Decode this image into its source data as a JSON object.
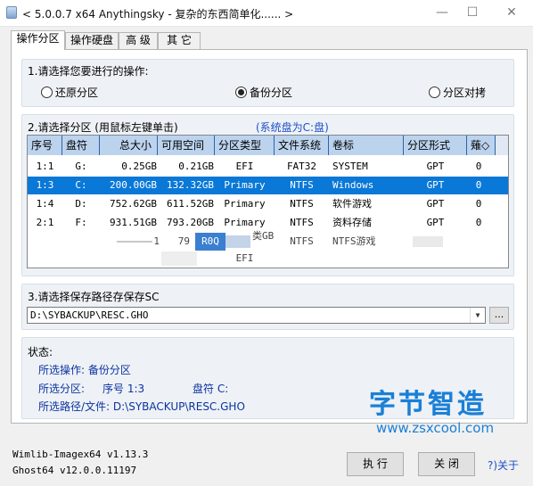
{
  "window": {
    "title": "< 5.0.0.7 x64 Anythingsky - 复杂的东西简单化...... >",
    "minimize": "—",
    "maximize": "☐",
    "close": "✕"
  },
  "tabs": [
    {
      "label": "操作分区",
      "active": true
    },
    {
      "label": "操作硬盘",
      "active": false
    },
    {
      "label": "高 级",
      "active": false
    },
    {
      "label": "其 它",
      "active": false
    }
  ],
  "operation": {
    "title": "1.请选择您要进行的操作:",
    "options": [
      {
        "label": "还原分区",
        "selected": false
      },
      {
        "label": "备份分区",
        "selected": true
      },
      {
        "label": "分区对拷",
        "selected": false
      }
    ]
  },
  "partition": {
    "title": "2.请选择分区 (用鼠标左键单击)",
    "system_disk_note": "(系统盘为C:盘)",
    "columns": [
      "序号",
      "盘符",
      "总大小",
      "可用空间",
      "分区类型",
      "文件系统",
      "卷标",
      "分区形式",
      "薙◇"
    ],
    "rows": [
      {
        "index": "1:1",
        "drive": "G:",
        "total": "0.25GB",
        "free": "0.21GB",
        "type": "EFI",
        "fs": "FAT32",
        "label": "SYSTEM",
        "scheme": "GPT",
        "last": "0",
        "selected": false
      },
      {
        "index": "1:3",
        "drive": "C:",
        "total": "200.00GB",
        "free": "132.32GB",
        "type": "Primary",
        "fs": "NTFS",
        "label": "Windows",
        "scheme": "GPT",
        "last": "0",
        "selected": true
      },
      {
        "index": "1:4",
        "drive": "D:",
        "total": "752.62GB",
        "free": "611.52GB",
        "type": "Primary",
        "fs": "NTFS",
        "label": "软件游戏",
        "scheme": "GPT",
        "last": "0",
        "selected": false
      },
      {
        "index": "2:1",
        "drive": "F:",
        "total": "931.51GB",
        "free": "793.20GB",
        "type": "Primary",
        "fs": "NTFS",
        "label": "资料存储",
        "scheme": "GPT",
        "last": "0",
        "selected": false
      },
      {
        "index": "",
        "drive": "",
        "total": "1",
        "free": "79",
        "type": "R0Q",
        "fs": "NTFS",
        "label": "NTFS游戏",
        "scheme": "",
        "last": "",
        "selected": false
      },
      {
        "index": "",
        "drive": "",
        "total": "",
        "free": "",
        "type": "EFI",
        "fs": "",
        "label": "",
        "scheme": "",
        "last": "",
        "selected": false
      }
    ],
    "glitch_text": "类GB"
  },
  "save_path": {
    "title": "3.请选择保存路径存保存SC",
    "value": "D:\\SYBACKUP\\RESC.GHO",
    "browse_label": "..."
  },
  "status": {
    "title": "状态:",
    "operation_line": "所选操作: 备份分区",
    "partition_label": "所选分区:",
    "partition_index": "序号 1:3",
    "partition_drive": "盘符 C:",
    "path_line": "所选路径/文件: D:\\SYBACKUP\\RESC.GHO"
  },
  "footer": {
    "wimlib": "Wimlib-Imagex64 v1.13.3",
    "ghost": "Ghost64 v12.0.0.11197",
    "execute_label": "执 行",
    "close_label": "关 闭",
    "about_label": "?)关于"
  },
  "watermark": {
    "main": "字节智造",
    "url": "www.zsxcool.com",
    "color": "#1a7fd6"
  },
  "colors": {
    "selection": "#0a78d7",
    "header": "#bcd3ee",
    "status_text": "#0b33a0",
    "group_bg": "#eef2f6"
  }
}
